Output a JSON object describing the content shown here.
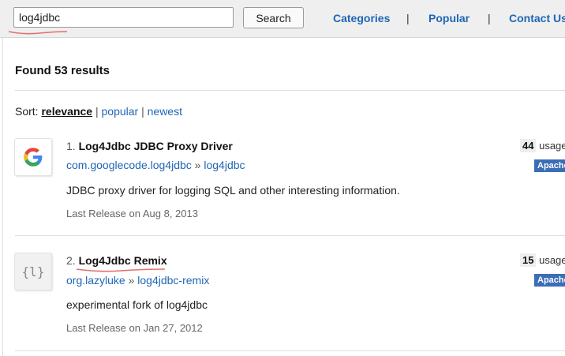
{
  "search": {
    "value": "log4jdbc",
    "button_label": "Search"
  },
  "nav": {
    "categories": "Categories",
    "popular": "Popular",
    "contact": "Contact Us",
    "separator": "|"
  },
  "results": {
    "found_text": "Found 53 results",
    "sort_label": "Sort:",
    "sort_options": [
      "relevance",
      "popular",
      "newest"
    ],
    "sort_separator": "|",
    "items": [
      {
        "number": "1.",
        "title": "Log4Jdbc JDBC Proxy Driver",
        "group": "com.googlecode.log4jdbc",
        "arrow": "»",
        "artifact": "log4jdbc",
        "description": "JDBC proxy driver for logging SQL and other interesting information.",
        "release": "Last Release on Aug 8, 2013",
        "usages_count": "44",
        "usages_label": "usages",
        "license": "Apache",
        "icon": "google-logo-icon",
        "colors": {
          "blue": "#4285F4",
          "red": "#EA4335",
          "yellow": "#FBBC05",
          "green": "#34A853"
        }
      },
      {
        "number": "2.",
        "title": "Log4Jdbc Remix",
        "group": "org.lazyluke",
        "arrow": "»",
        "artifact": "log4jdbc-remix",
        "description": "experimental fork of log4jdbc",
        "release": "Last Release on Jan 27, 2012",
        "usages_count": "15",
        "usages_label": "usages",
        "license": "Apache",
        "icon": "placeholder-logo-icon",
        "icon_text": "{l}"
      }
    ]
  },
  "colors": {
    "link": "#1f66b5",
    "license_badge": "#3b6eb7",
    "annotation": "#e0706f"
  }
}
